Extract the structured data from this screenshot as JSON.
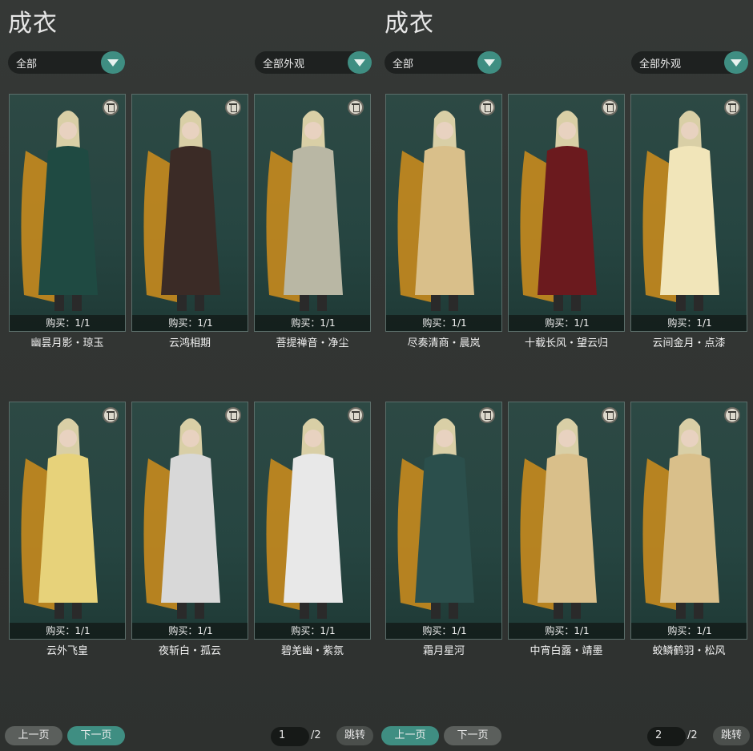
{
  "left": {
    "title": "成衣",
    "filter1": "全部",
    "filter2": "全部外观",
    "items": [
      {
        "buy": "购买：1/1",
        "name": "幽昙月影・琼玉",
        "color": "#1f4a42"
      },
      {
        "buy": "购买：1/1",
        "name": "云鸿相期",
        "color": "#3b2b26"
      },
      {
        "buy": "购买：1/1",
        "name": "菩提禅音・净尘",
        "color": "#b9b7a4"
      },
      {
        "buy": "购买：1/1",
        "name": "云外飞皇",
        "color": "#e7d27a"
      },
      {
        "buy": "购买：1/1",
        "name": "夜斩白・孤云",
        "color": "#d8d8d8"
      },
      {
        "buy": "购买：1/1",
        "name": "碧羌幽・紫氛",
        "color": "#e8e8e8"
      }
    ],
    "prev": "上一页",
    "next": "下一页",
    "page": "1",
    "total": "/2",
    "jump": "跳转"
  },
  "right": {
    "title": "成衣",
    "filter1": "全部",
    "filter2": "全部外观",
    "items": [
      {
        "buy": "购买：1/1",
        "name": "尽奏清商・晨岚",
        "color": "#d9bf8a"
      },
      {
        "buy": "购买：1/1",
        "name": "十载长风・望云归",
        "color": "#6b1a1e"
      },
      {
        "buy": "购买：1/1",
        "name": "云间金月・点漆",
        "color": "#f1e5b9"
      },
      {
        "buy": "购买：1/1",
        "name": "霜月星河",
        "color": "#2b4f4c"
      },
      {
        "buy": "购买：1/1",
        "name": "中宵白露・靖墨",
        "color": "#d9bf8a"
      },
      {
        "buy": "购买：1/1",
        "name": "蛟鳞鹤羽・松风",
        "color": "#d9bf8a"
      }
    ],
    "prev": "上一页",
    "next": "下一页",
    "page": "2",
    "total": "/2",
    "jump": "跳转"
  },
  "icons": {
    "trash": "trash-icon",
    "dropdown": "chevron-down-icon"
  }
}
